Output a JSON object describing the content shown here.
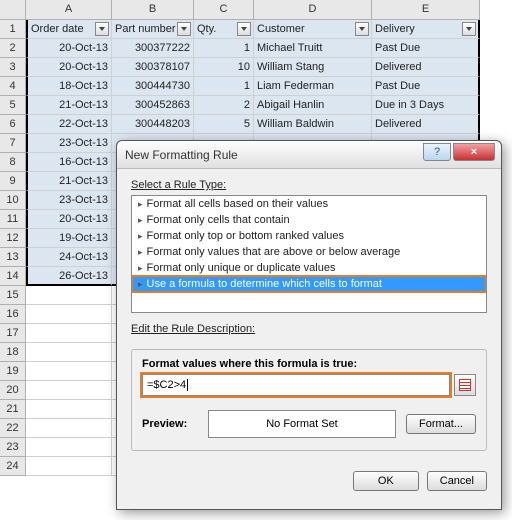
{
  "columns": {
    "A": "A",
    "B": "B",
    "C": "C",
    "D": "D",
    "E": "E"
  },
  "headers": {
    "A": "Order date",
    "B": "Part number",
    "C": "Qty.",
    "D": "Customer",
    "E": "Delivery"
  },
  "rows": [
    {
      "n": "2",
      "A": "20-Oct-13",
      "B": "300377222",
      "C": "1",
      "D": "Michael Truitt",
      "E": "Past Due"
    },
    {
      "n": "3",
      "A": "20-Oct-13",
      "B": "300378107",
      "C": "10",
      "D": "William Stang",
      "E": "Delivered"
    },
    {
      "n": "4",
      "A": "18-Oct-13",
      "B": "300444730",
      "C": "1",
      "D": "Liam Federman",
      "E": "Past Due"
    },
    {
      "n": "5",
      "A": "21-Oct-13",
      "B": "300452863",
      "C": "2",
      "D": "Abigail Hanlin",
      "E": "Due in 3 Days"
    },
    {
      "n": "6",
      "A": "22-Oct-13",
      "B": "300448203",
      "C": "5",
      "D": "William Baldwin",
      "E": "Delivered"
    },
    {
      "n": "7",
      "A": "23-Oct-13",
      "B": "",
      "C": "",
      "D": "",
      "E": ""
    },
    {
      "n": "8",
      "A": "16-Oct-13",
      "B": "",
      "C": "",
      "D": "",
      "E": ""
    },
    {
      "n": "9",
      "A": "21-Oct-13",
      "B": "",
      "C": "",
      "D": "",
      "E": ""
    },
    {
      "n": "10",
      "A": "23-Oct-13",
      "B": "",
      "C": "",
      "D": "",
      "E": ""
    },
    {
      "n": "11",
      "A": "20-Oct-13",
      "B": "",
      "C": "",
      "D": "",
      "E": ""
    },
    {
      "n": "12",
      "A": "19-Oct-13",
      "B": "",
      "C": "",
      "D": "",
      "E": ""
    },
    {
      "n": "13",
      "A": "24-Oct-13",
      "B": "",
      "C": "",
      "D": "",
      "E": ""
    },
    {
      "n": "14",
      "A": "26-Oct-13",
      "B": "",
      "C": "",
      "D": "",
      "E": ""
    }
  ],
  "empty_rows": [
    "15",
    "16",
    "17",
    "18",
    "19",
    "20",
    "21",
    "22",
    "23",
    "24"
  ],
  "dialog": {
    "title": "New Formatting Rule",
    "select_label": "Select a Rule Type:",
    "rule_types": [
      "Format all cells based on their values",
      "Format only cells that contain",
      "Format only top or bottom ranked values",
      "Format only values that are above or below average",
      "Format only unique or duplicate values",
      "Use a formula to determine which cells to format"
    ],
    "edit_label": "Edit the Rule Description:",
    "formula_label": "Format values where this formula is true:",
    "formula_value": "=$C2>4",
    "preview_label": "Preview:",
    "preview_text": "No Format Set",
    "format_btn": "Format...",
    "ok": "OK",
    "cancel": "Cancel",
    "help": "?",
    "close": "×"
  }
}
